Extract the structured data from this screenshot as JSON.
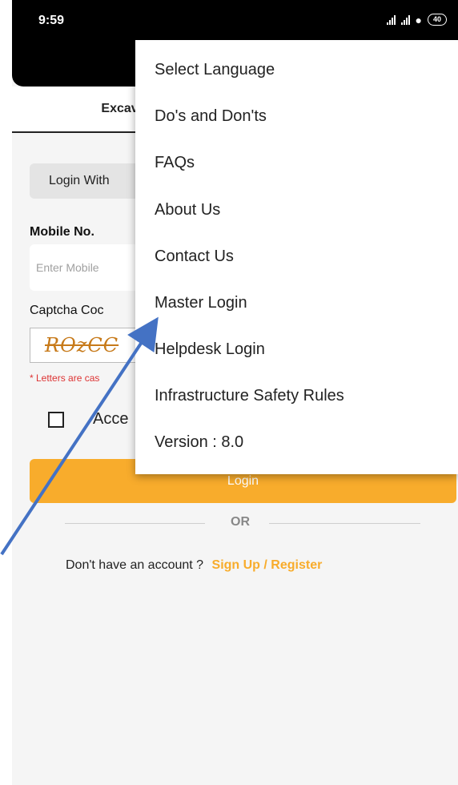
{
  "status_bar": {
    "time": "9:59",
    "battery": "40"
  },
  "tabs": {
    "active_label": "Excava"
  },
  "form": {
    "login_with_label": "Login With",
    "mobile_label": "Mobile No.",
    "mobile_placeholder": "Enter Mobile",
    "captcha_label": "Captcha Coc",
    "captcha_value": "ROzCC",
    "captcha_note": "* Letters are cas",
    "accept_label": "Acce",
    "login_button": "Login",
    "or_text": "OR",
    "signup_prompt": "Don't have an account ?",
    "signup_link": "Sign Up / Register"
  },
  "menu": {
    "items": [
      "Select Language",
      "Do's and Don'ts",
      "FAQs",
      "About Us",
      "Contact Us",
      "Master Login",
      "Helpdesk Login",
      "Infrastructure Safety Rules",
      "Version : 8.0"
    ]
  },
  "colors": {
    "accent": "#f8ac2c",
    "annotation_arrow": "#4472c4",
    "error": "#dd3333"
  }
}
